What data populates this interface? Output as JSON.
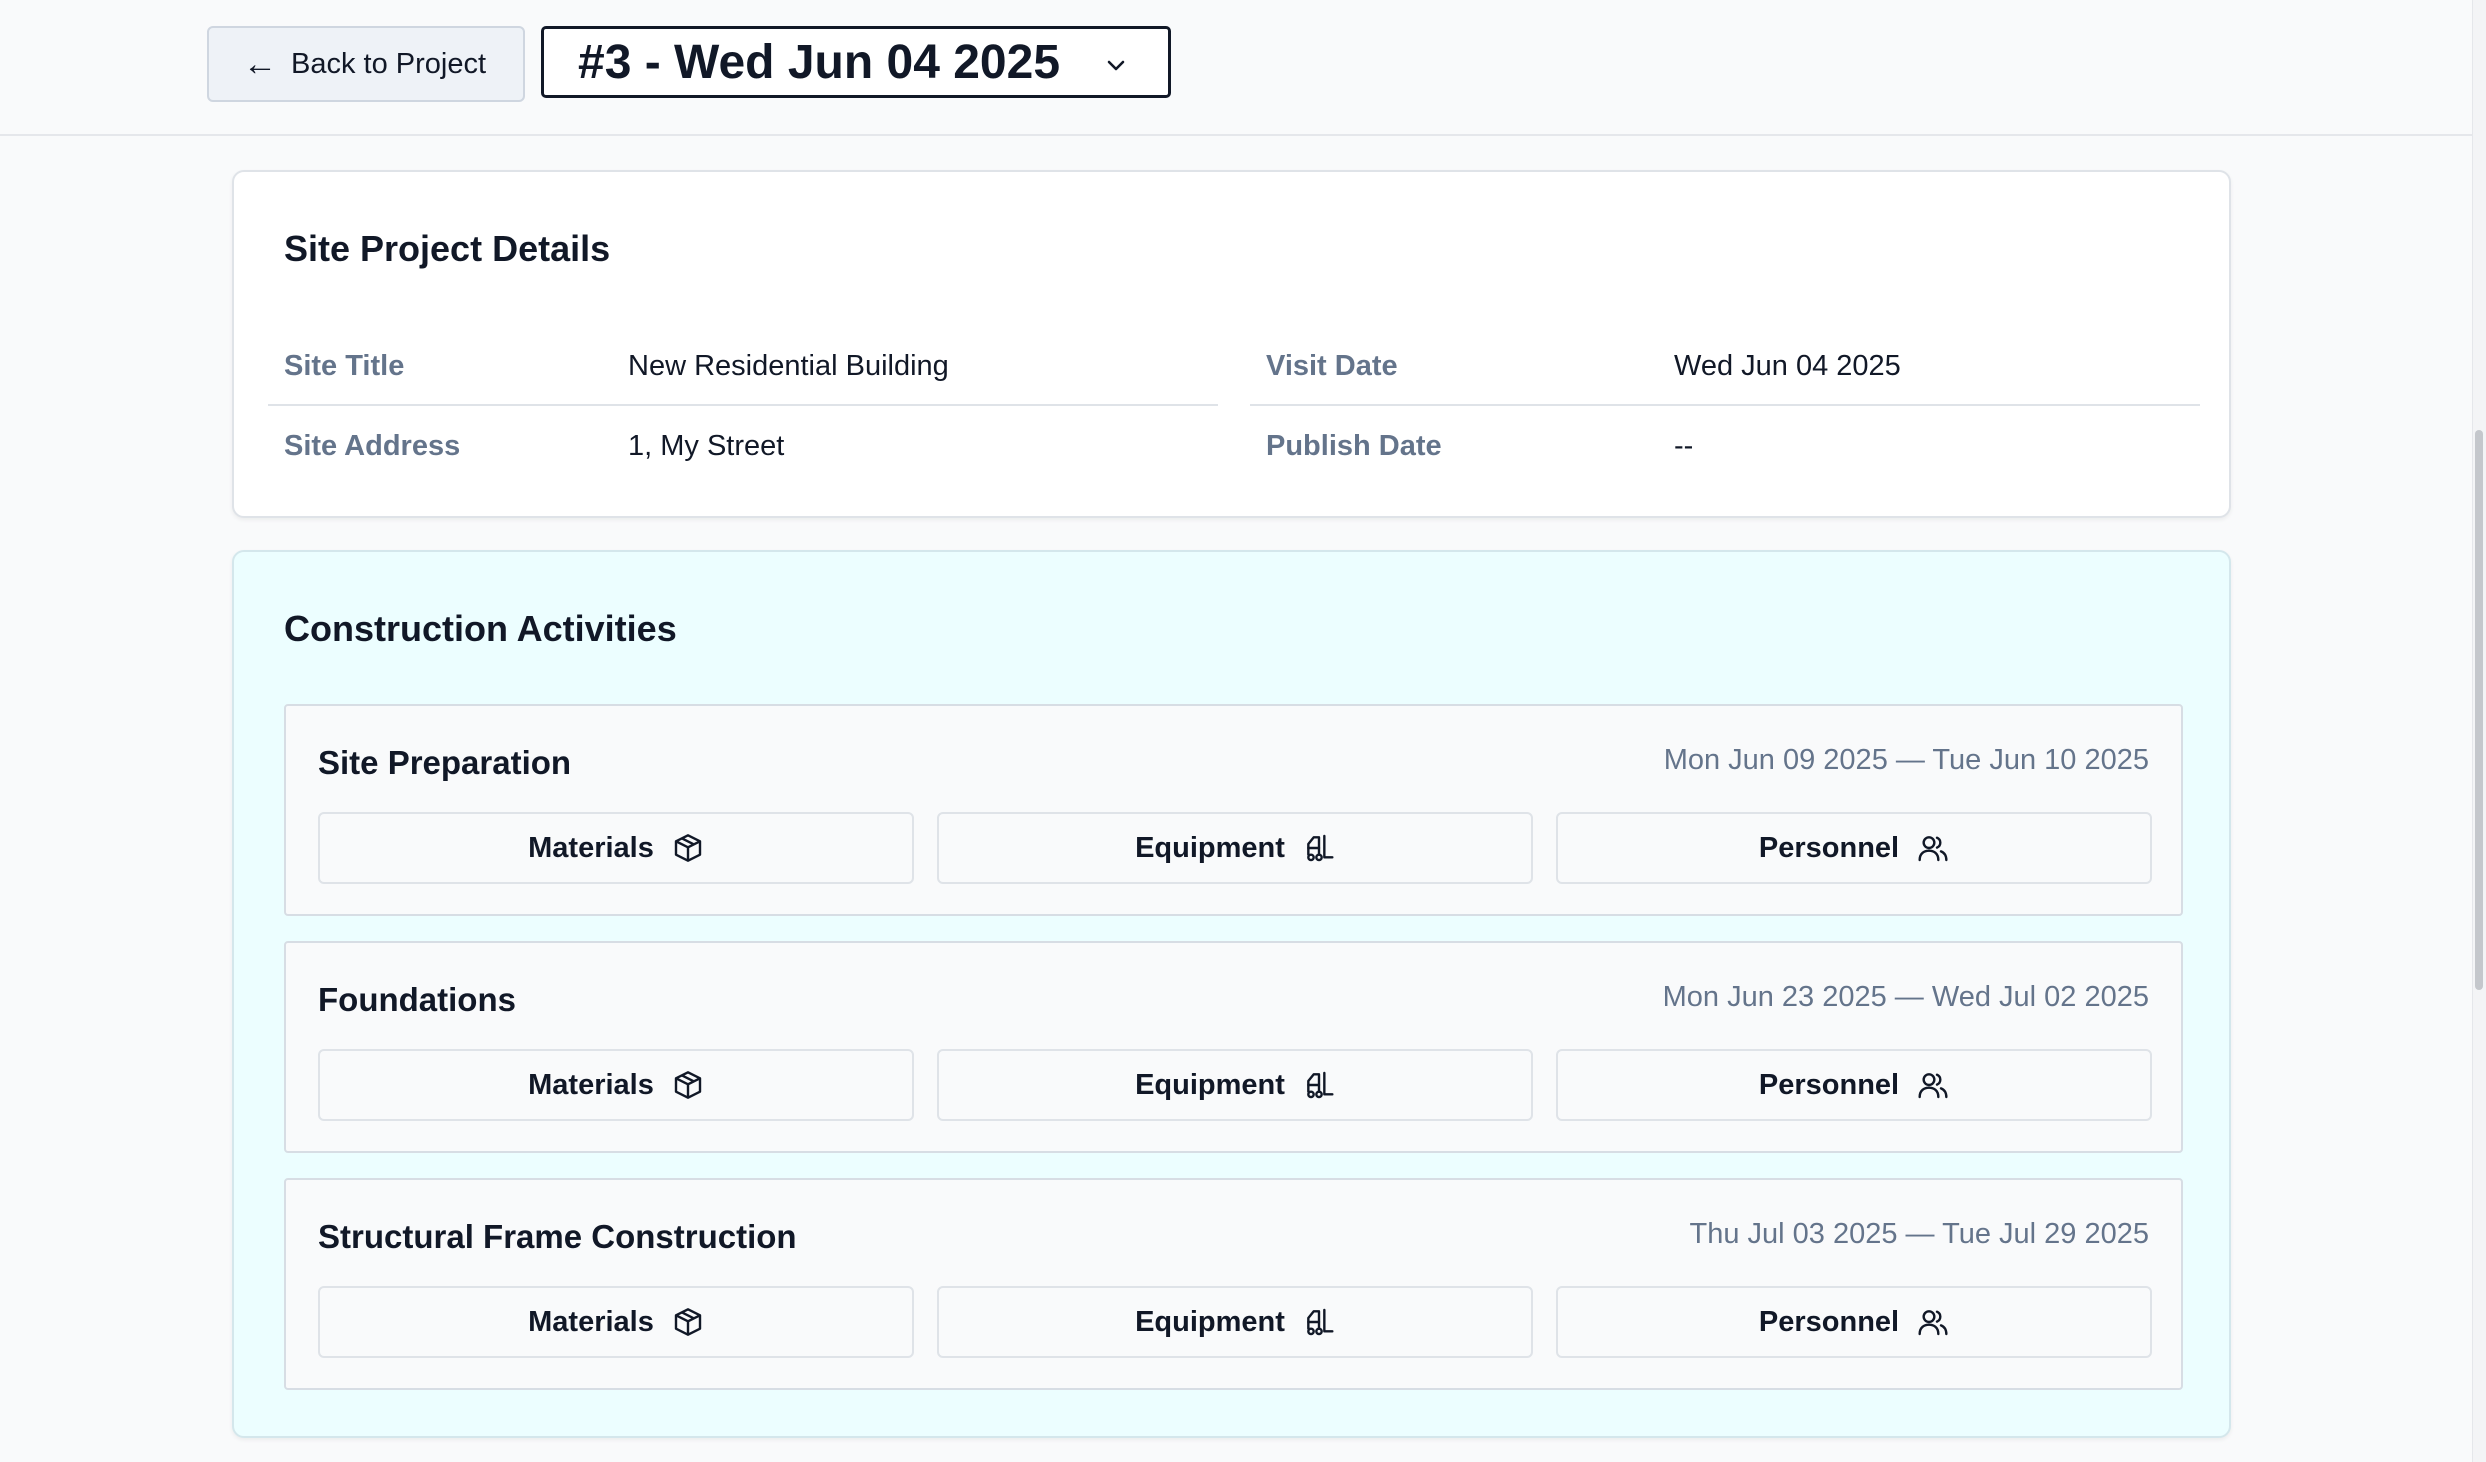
{
  "header": {
    "back_label": "Back to Project",
    "back_arrow": "←",
    "visit_selected": "#3 - Wed Jun 04 2025"
  },
  "details": {
    "title": "Site Project Details",
    "fields": [
      {
        "label": "Site Title",
        "value": "New Residential Building"
      },
      {
        "label": "Visit Date",
        "value": "Wed Jun 04 2025"
      },
      {
        "label": "Site Address",
        "value": "1, My Street"
      },
      {
        "label": "Publish Date",
        "value": "--"
      }
    ]
  },
  "activities": {
    "title": "Construction Activities",
    "items": [
      {
        "name": "Site Preparation",
        "dates": "Mon Jun 09 2025 — Tue Jun 10 2025",
        "materials": "Materials",
        "equipment": "Equipment",
        "personnel": "Personnel"
      },
      {
        "name": "Foundations",
        "dates": "Mon Jun 23 2025 — Wed Jul 02 2025",
        "materials": "Materials",
        "equipment": "Equipment",
        "personnel": "Personnel"
      },
      {
        "name": "Structural Frame Construction",
        "dates": "Thu Jul 03 2025 — Tue Jul 29 2025",
        "materials": "Materials",
        "equipment": "Equipment",
        "personnel": "Personnel"
      }
    ]
  },
  "icons": {
    "back": "arrow-left-icon",
    "select": "chevron-down-icon",
    "materials": "box-icon",
    "equipment": "forklift-icon",
    "personnel": "users-icon"
  },
  "colors": {
    "activities_bg": "#ecfeff",
    "label_gray": "#64748b",
    "border": "#dfe3e8"
  }
}
